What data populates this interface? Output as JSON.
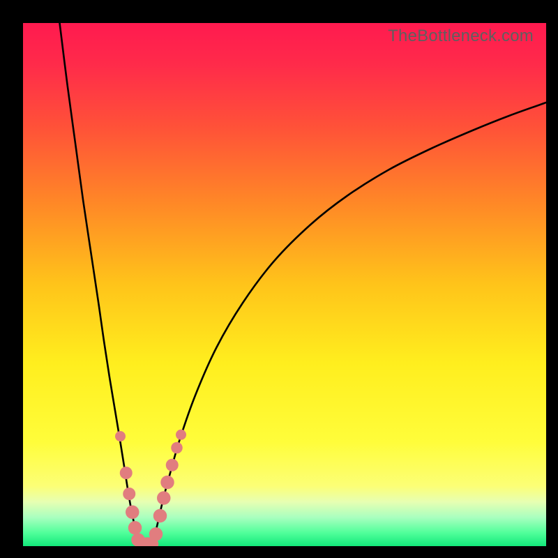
{
  "watermark": "TheBottleneck.com",
  "chart_data": {
    "type": "line",
    "title": "",
    "xlabel": "",
    "ylabel": "",
    "xlim": [
      0,
      100
    ],
    "ylim": [
      0,
      100
    ],
    "grid": false,
    "background_gradient_stops": [
      {
        "offset": 0.0,
        "color": "#ff1a4f"
      },
      {
        "offset": 0.08,
        "color": "#ff2b4a"
      },
      {
        "offset": 0.2,
        "color": "#ff5238"
      },
      {
        "offset": 0.35,
        "color": "#ff8a26"
      },
      {
        "offset": 0.5,
        "color": "#ffc41a"
      },
      {
        "offset": 0.65,
        "color": "#ffee1e"
      },
      {
        "offset": 0.8,
        "color": "#fffd3a"
      },
      {
        "offset": 0.885,
        "color": "#fcff76"
      },
      {
        "offset": 0.915,
        "color": "#e7ffb2"
      },
      {
        "offset": 0.945,
        "color": "#a9ffbf"
      },
      {
        "offset": 0.975,
        "color": "#4fff9a"
      },
      {
        "offset": 1.0,
        "color": "#12e87a"
      }
    ],
    "series": [
      {
        "name": "left-branch",
        "x": [
          7.0,
          8.5,
          10.0,
          11.5,
          13.0,
          14.5,
          15.5,
          16.5,
          17.5,
          18.5,
          19.3,
          20.0,
          20.6,
          21.2,
          21.8,
          22.3
        ],
        "y": [
          100.0,
          88.0,
          77.0,
          66.0,
          56.0,
          46.0,
          39.0,
          32.5,
          26.5,
          20.5,
          15.5,
          11.0,
          7.5,
          4.5,
          2.0,
          0.5
        ]
      },
      {
        "name": "right-branch",
        "x": [
          24.8,
          25.3,
          26.0,
          26.8,
          28.0,
          30.0,
          33.0,
          37.0,
          42.0,
          48.0,
          55.0,
          62.0,
          70.0,
          78.0,
          86.0,
          93.0,
          100.0
        ],
        "y": [
          0.5,
          2.5,
          5.5,
          9.0,
          13.5,
          20.5,
          29.0,
          38.0,
          46.5,
          54.5,
          61.5,
          67.0,
          72.0,
          76.0,
          79.5,
          82.3,
          84.8
        ]
      }
    ],
    "valley_floor": {
      "x": [
        22.3,
        24.8
      ],
      "y": [
        0.5,
        0.5
      ]
    },
    "scatter": {
      "name": "markers",
      "points": [
        {
          "x": 18.6,
          "y": 21.0,
          "r": 1.0
        },
        {
          "x": 19.7,
          "y": 14.0,
          "r": 1.2
        },
        {
          "x": 20.3,
          "y": 10.0,
          "r": 1.2
        },
        {
          "x": 20.9,
          "y": 6.5,
          "r": 1.3
        },
        {
          "x": 21.4,
          "y": 3.5,
          "r": 1.3
        },
        {
          "x": 22.0,
          "y": 1.2,
          "r": 1.3
        },
        {
          "x": 22.9,
          "y": 0.4,
          "r": 1.3
        },
        {
          "x": 23.8,
          "y": 0.4,
          "r": 1.3
        },
        {
          "x": 24.6,
          "y": 0.4,
          "r": 1.3
        },
        {
          "x": 25.4,
          "y": 2.3,
          "r": 1.3
        },
        {
          "x": 26.2,
          "y": 5.8,
          "r": 1.3
        },
        {
          "x": 26.9,
          "y": 9.2,
          "r": 1.3
        },
        {
          "x": 27.6,
          "y": 12.2,
          "r": 1.3
        },
        {
          "x": 28.5,
          "y": 15.5,
          "r": 1.2
        },
        {
          "x": 29.4,
          "y": 18.8,
          "r": 1.1
        },
        {
          "x": 30.2,
          "y": 21.3,
          "r": 1.0
        }
      ]
    }
  }
}
